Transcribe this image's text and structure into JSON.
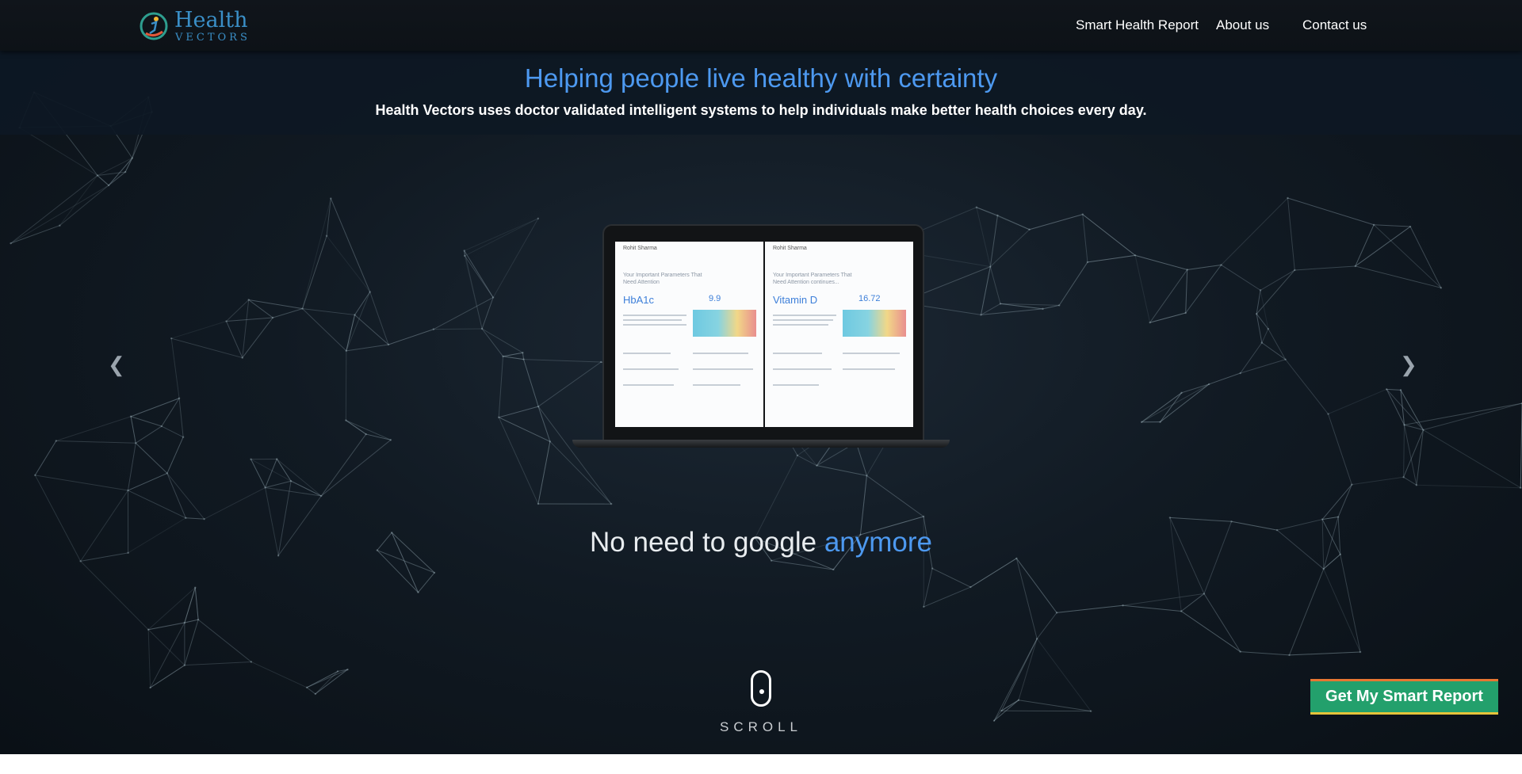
{
  "header": {
    "logo": {
      "line1": "Health",
      "line2": "VECTORS"
    },
    "nav": [
      {
        "label": "Smart Health Report"
      },
      {
        "label": "About us"
      },
      {
        "label": "Contact us"
      }
    ]
  },
  "hero": {
    "title": "Helping people live healthy with certainty",
    "subtitle": "Health Vectors uses doctor validated intelligent systems to help individuals make better health choices every day."
  },
  "carousel": {
    "prev_icon": "chevron-left-icon",
    "next_icon": "chevron-right-icon",
    "slide": {
      "pages": [
        {
          "name": "Rohit Sharma",
          "section": "Your Important Parameters That Need Attention",
          "parameter": "HbA1c",
          "result": "9.9"
        },
        {
          "name": "Rohit Sharma",
          "section": "Your Important Parameters That Need Attention continues...",
          "parameter": "Vitamin D",
          "result": "16.72"
        }
      ],
      "tagline_main": "No need to google ",
      "tagline_highlight": "anymore"
    }
  },
  "scroll": {
    "label": "SCROLL",
    "icon": "mouse-icon"
  },
  "cta": {
    "label": "Get My Smart Report"
  },
  "colors": {
    "accent": "#4d99f0",
    "cta_bg": "#23a06c",
    "cta_top": "#e77632",
    "cta_bottom": "#e6c33b",
    "background": "#111a23"
  }
}
